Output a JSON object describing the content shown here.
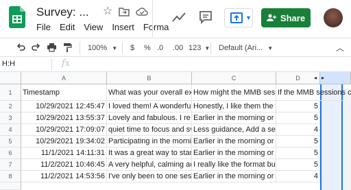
{
  "header": {
    "title": "Survey: ...",
    "menu": [
      "File",
      "Edit",
      "View",
      "Insert",
      "Forma"
    ],
    "share_label": "Share"
  },
  "toolbar": {
    "zoom": "100%",
    "currency": "$",
    "percent": "%",
    "dec_decrease": ".0",
    "dec_increase": ".00",
    "more_formats": "123",
    "font": "Default (Ari..."
  },
  "formula": {
    "name_box": "H:H",
    "fx": "fx"
  },
  "grid": {
    "columns": [
      "A",
      "B",
      "C",
      "D"
    ],
    "row_numbers": [
      "1",
      "2",
      "3",
      "4",
      "5",
      "6",
      "7",
      "8"
    ],
    "header_cells": [
      "Timestamp",
      "What was your overall ex",
      "How might the MMB sess",
      "If the MMB sessions continue"
    ],
    "rows": [
      [
        "10/29/2021 12:45:47",
        "I loved them! A wonderfu",
        "Honestly, I like them the w",
        "5"
      ],
      [
        "10/29/2021 13:55:37",
        "Lovely and fabulous. I re",
        "Earlier in the morning or",
        "5"
      ],
      [
        "10/29/2021 17:09:07",
        "quiet time to focus and sv",
        "Less guidance, Add a ses",
        "4"
      ],
      [
        "10/29/2021 19:34:02",
        "Participating in the morni",
        "Earlier in the morning or",
        "5"
      ],
      [
        "11/1/2021 14:11:31",
        "It was a great way to star",
        "Earlier in the morning or",
        "5"
      ],
      [
        "11/2/2021 10:46:45",
        "A very helpful, calming ac",
        "I really like the format but",
        "5"
      ],
      [
        "11/2/2021 14:53:56",
        "I've only been to one ses",
        "Earlier in the morning or",
        "4"
      ]
    ]
  },
  "colors": {
    "share_green": "#188038",
    "sheets_green": "#0f9d58",
    "selection_blue": "#1a73e8"
  }
}
